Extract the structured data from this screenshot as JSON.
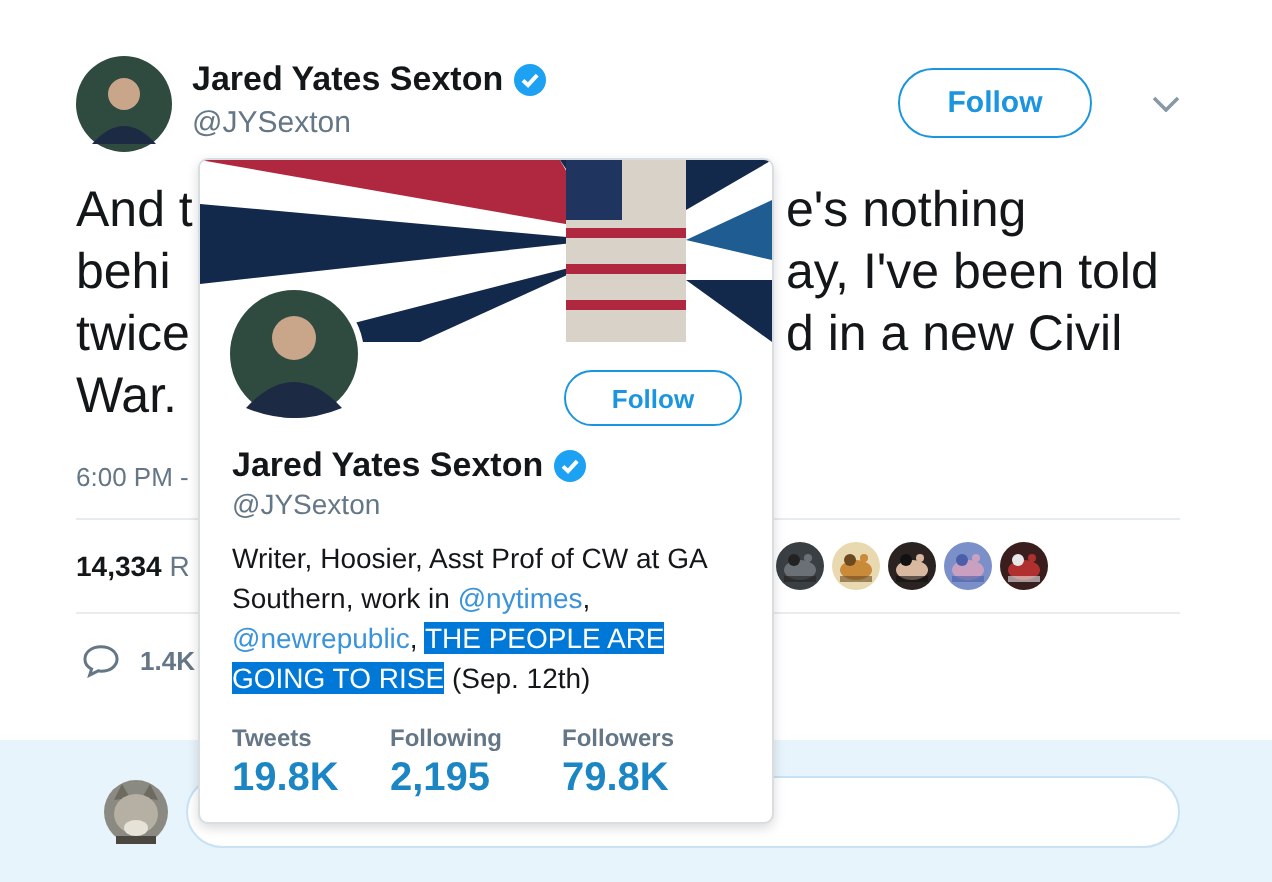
{
  "tweet": {
    "author": {
      "name": "Jared Yates Sexton",
      "handle": "@JYSexton",
      "verified": true
    },
    "follow_button": "Follow",
    "text_lines": [
      {
        "left": "And t",
        "right": "e's nothing"
      },
      {
        "left": "behi",
        "right": "ay, I've been told"
      },
      {
        "left": "twice",
        "right": "d in a new Civil"
      },
      {
        "left": "War."
      }
    ],
    "time": "6:00 PM -",
    "stats": {
      "count": "14,334",
      "label": "R"
    },
    "reply_count": "1.4K"
  },
  "profile_card": {
    "name": "Jared Yates Sexton",
    "handle": "@JYSexton",
    "verified": true,
    "follow_button": "Follow",
    "bio": [
      {
        "kind": "text",
        "text": "Writer, Hoosier, Asst Prof of CW at GA Southern, work in "
      },
      {
        "kind": "link",
        "text": "@nytimes"
      },
      {
        "kind": "text",
        "text": ", "
      },
      {
        "kind": "link",
        "text": "@newrepublic"
      },
      {
        "kind": "text",
        "text": ", "
      },
      {
        "kind": "selected",
        "text": "THE PEOPLE ARE GOING TO RISE"
      },
      {
        "kind": "text",
        "text": " (Sep. 12th)"
      }
    ],
    "stats": [
      {
        "label": "Tweets",
        "value": "19.8K"
      },
      {
        "label": "Following",
        "value": "2,195"
      },
      {
        "label": "Followers",
        "value": "79.8K"
      }
    ]
  }
}
